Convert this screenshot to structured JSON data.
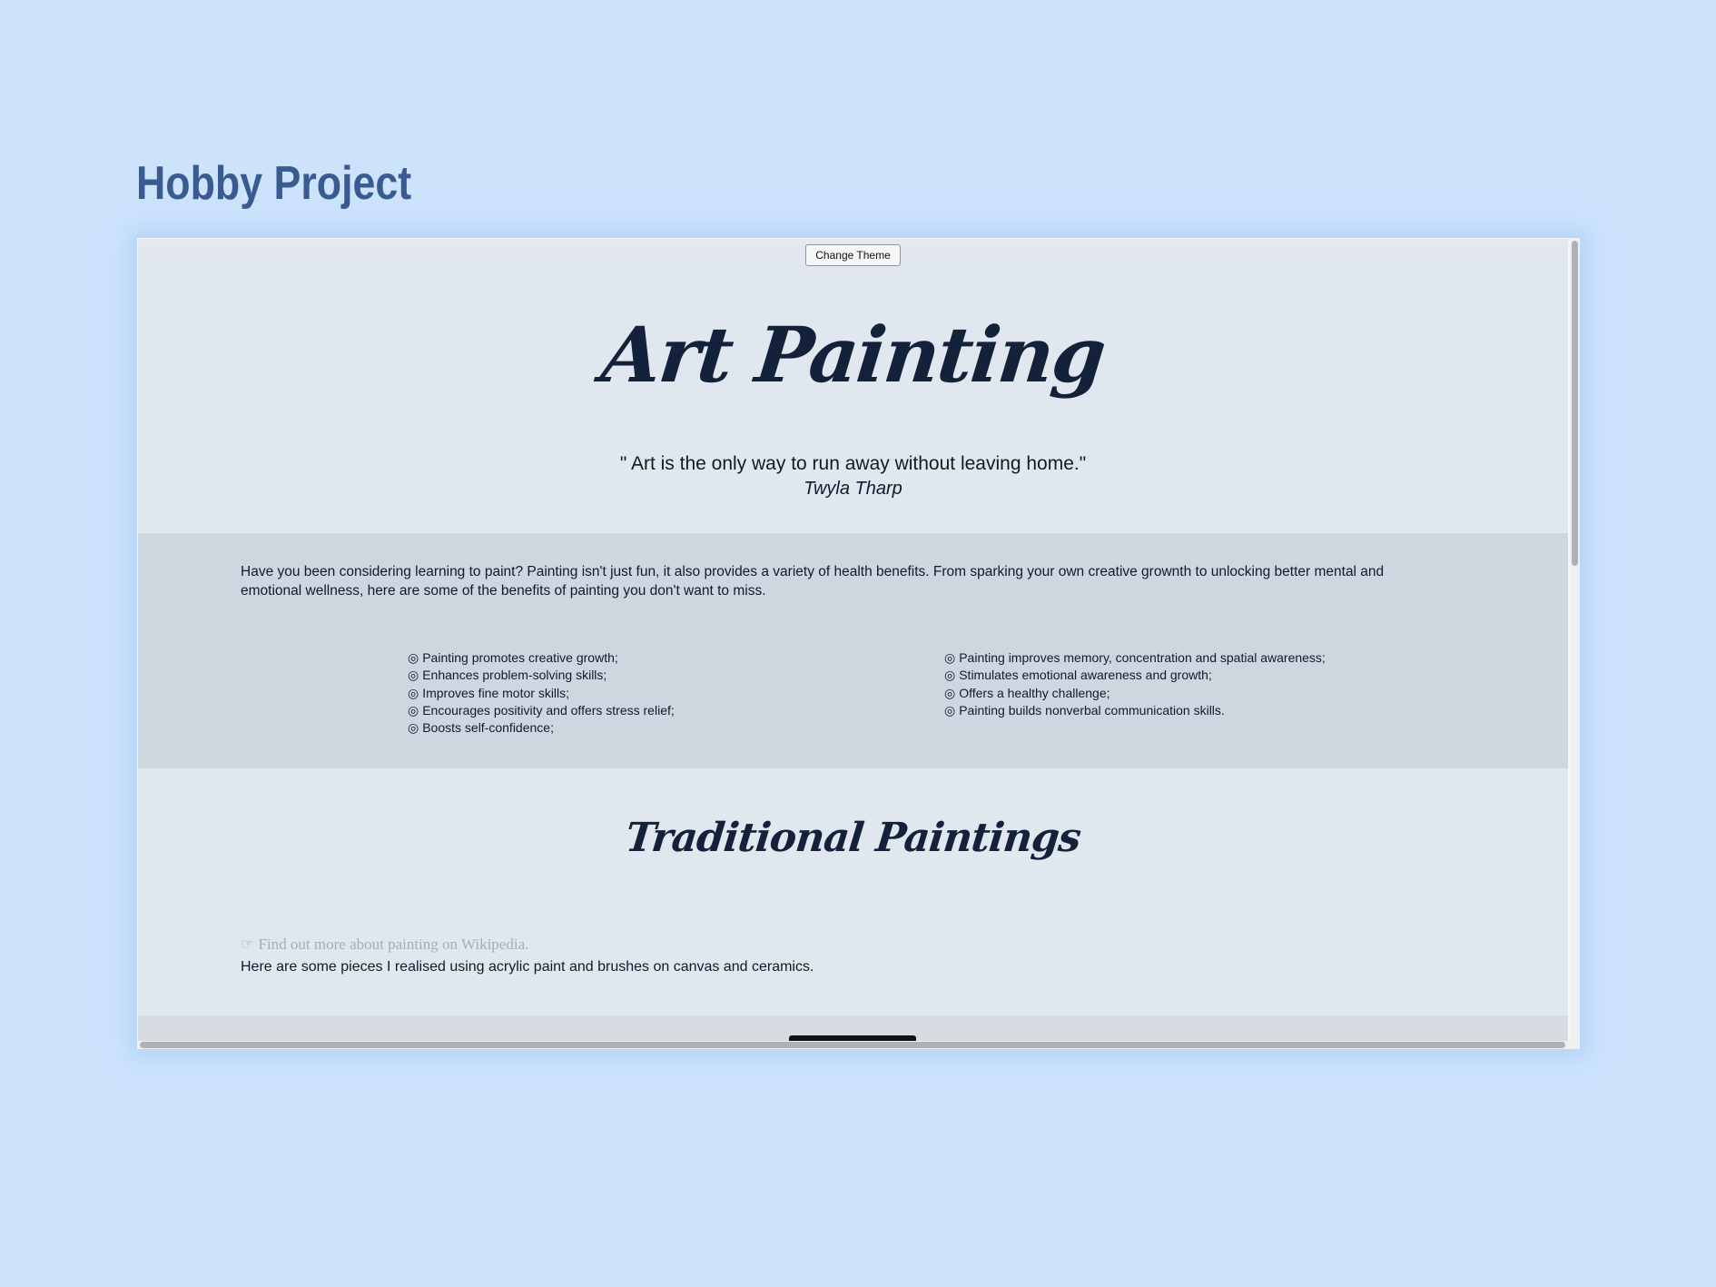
{
  "page": {
    "title": "Hobby Project"
  },
  "site": {
    "theme_button_label": "Change Theme",
    "hero_title": "Art Painting",
    "quote_text": "\" Art is the only way to run away without leaving home.\"",
    "quote_author": "Twyla Tharp",
    "intro": "Have you been considering learning to paint? Painting isn't just fun, it also provides a variety of health benefits. From sparking your own creative grownth to unlocking better mental and emotional wellness, here are some of the benefits of painting you don't want to miss.",
    "bullet_glyph": "◎",
    "benefits_left": [
      "Painting promotes creative growth;",
      "Enhances problem-solving skills;",
      "Improves fine motor skills;",
      "Encourages positivity and offers stress relief;",
      "Boosts self-confidence;"
    ],
    "benefits_right": [
      "Painting improves memory, concentration and spatial awareness;",
      "Stimulates emotional awareness and growth;",
      "Offers a healthy challenge;",
      "Painting builds nonverbal communication skills."
    ],
    "section_title": "Traditional Paintings",
    "wiki_link": "☞ Find out more about painting on Wikipedia.",
    "pieces_text": "Here are some pieces I realised using acrylic paint and brushes on canvas and ceramics."
  },
  "colors": {
    "page_background": "#cde3fc",
    "outer_title": "#3a5b8f",
    "content_background": "#e0e7ef",
    "benefits_band": "#cdd7e0",
    "text": "#111a2b",
    "link": "#a8adb4"
  }
}
